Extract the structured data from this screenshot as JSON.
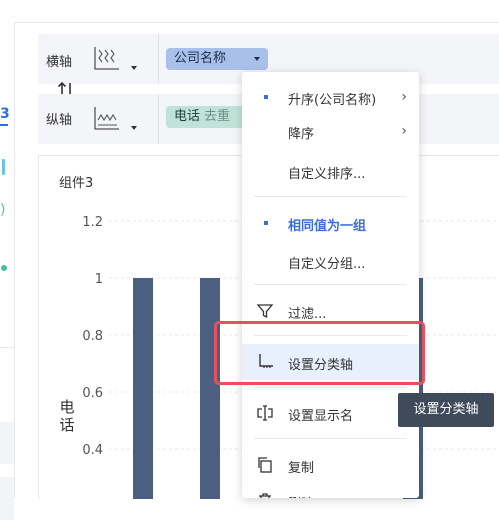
{
  "left_panel": {
    "visible_digit": "3",
    "visible_paren": ")"
  },
  "axes": {
    "x_label": "横轴",
    "y_label": "纵轴",
    "x_field_chip": "公司名称",
    "y_field_chip": "电话",
    "y_field_chip_sub": "去重"
  },
  "chart": {
    "title": "组件3",
    "ylabel_chars": [
      "电",
      "话"
    ]
  },
  "chart_data": {
    "type": "bar",
    "title": "组件3",
    "ylabel": "电话",
    "yticks": [
      "1.2",
      "1",
      "0.8",
      "0.6",
      "0.4"
    ],
    "ylim": [
      0.4,
      1.2
    ],
    "values": [
      1,
      1,
      1,
      1
    ],
    "bar_color": "#4d5f80",
    "grid": true
  },
  "menu": {
    "items": [
      {
        "label": "升序(公司名称)",
        "selected_dot": true,
        "submenu": true
      },
      {
        "label": "降序",
        "submenu": true
      },
      {
        "label": "自定义排序..."
      },
      {
        "label": "相同值为一组",
        "selected_dot": true,
        "selected": true
      },
      {
        "label": "自定义分组..."
      },
      {
        "label": "过滤...",
        "icon": "filter-icon"
      },
      {
        "label": "设置分类轴",
        "icon": "category-axis-icon",
        "hover": true
      },
      {
        "label": "设置显示名",
        "icon": "rename-icon"
      },
      {
        "label": "复制",
        "icon": "copy-icon"
      },
      {
        "label": "删除",
        "icon": "delete-icon"
      }
    ]
  },
  "tooltip": {
    "text": "设置分类轴"
  },
  "colors": {
    "accent": "#3b6fd6",
    "highlight_border": "#e8505b",
    "chip_blue": "#a8c0ea",
    "chip_green": "#bfe3d8",
    "tooltip_bg": "#3f4a5a"
  }
}
